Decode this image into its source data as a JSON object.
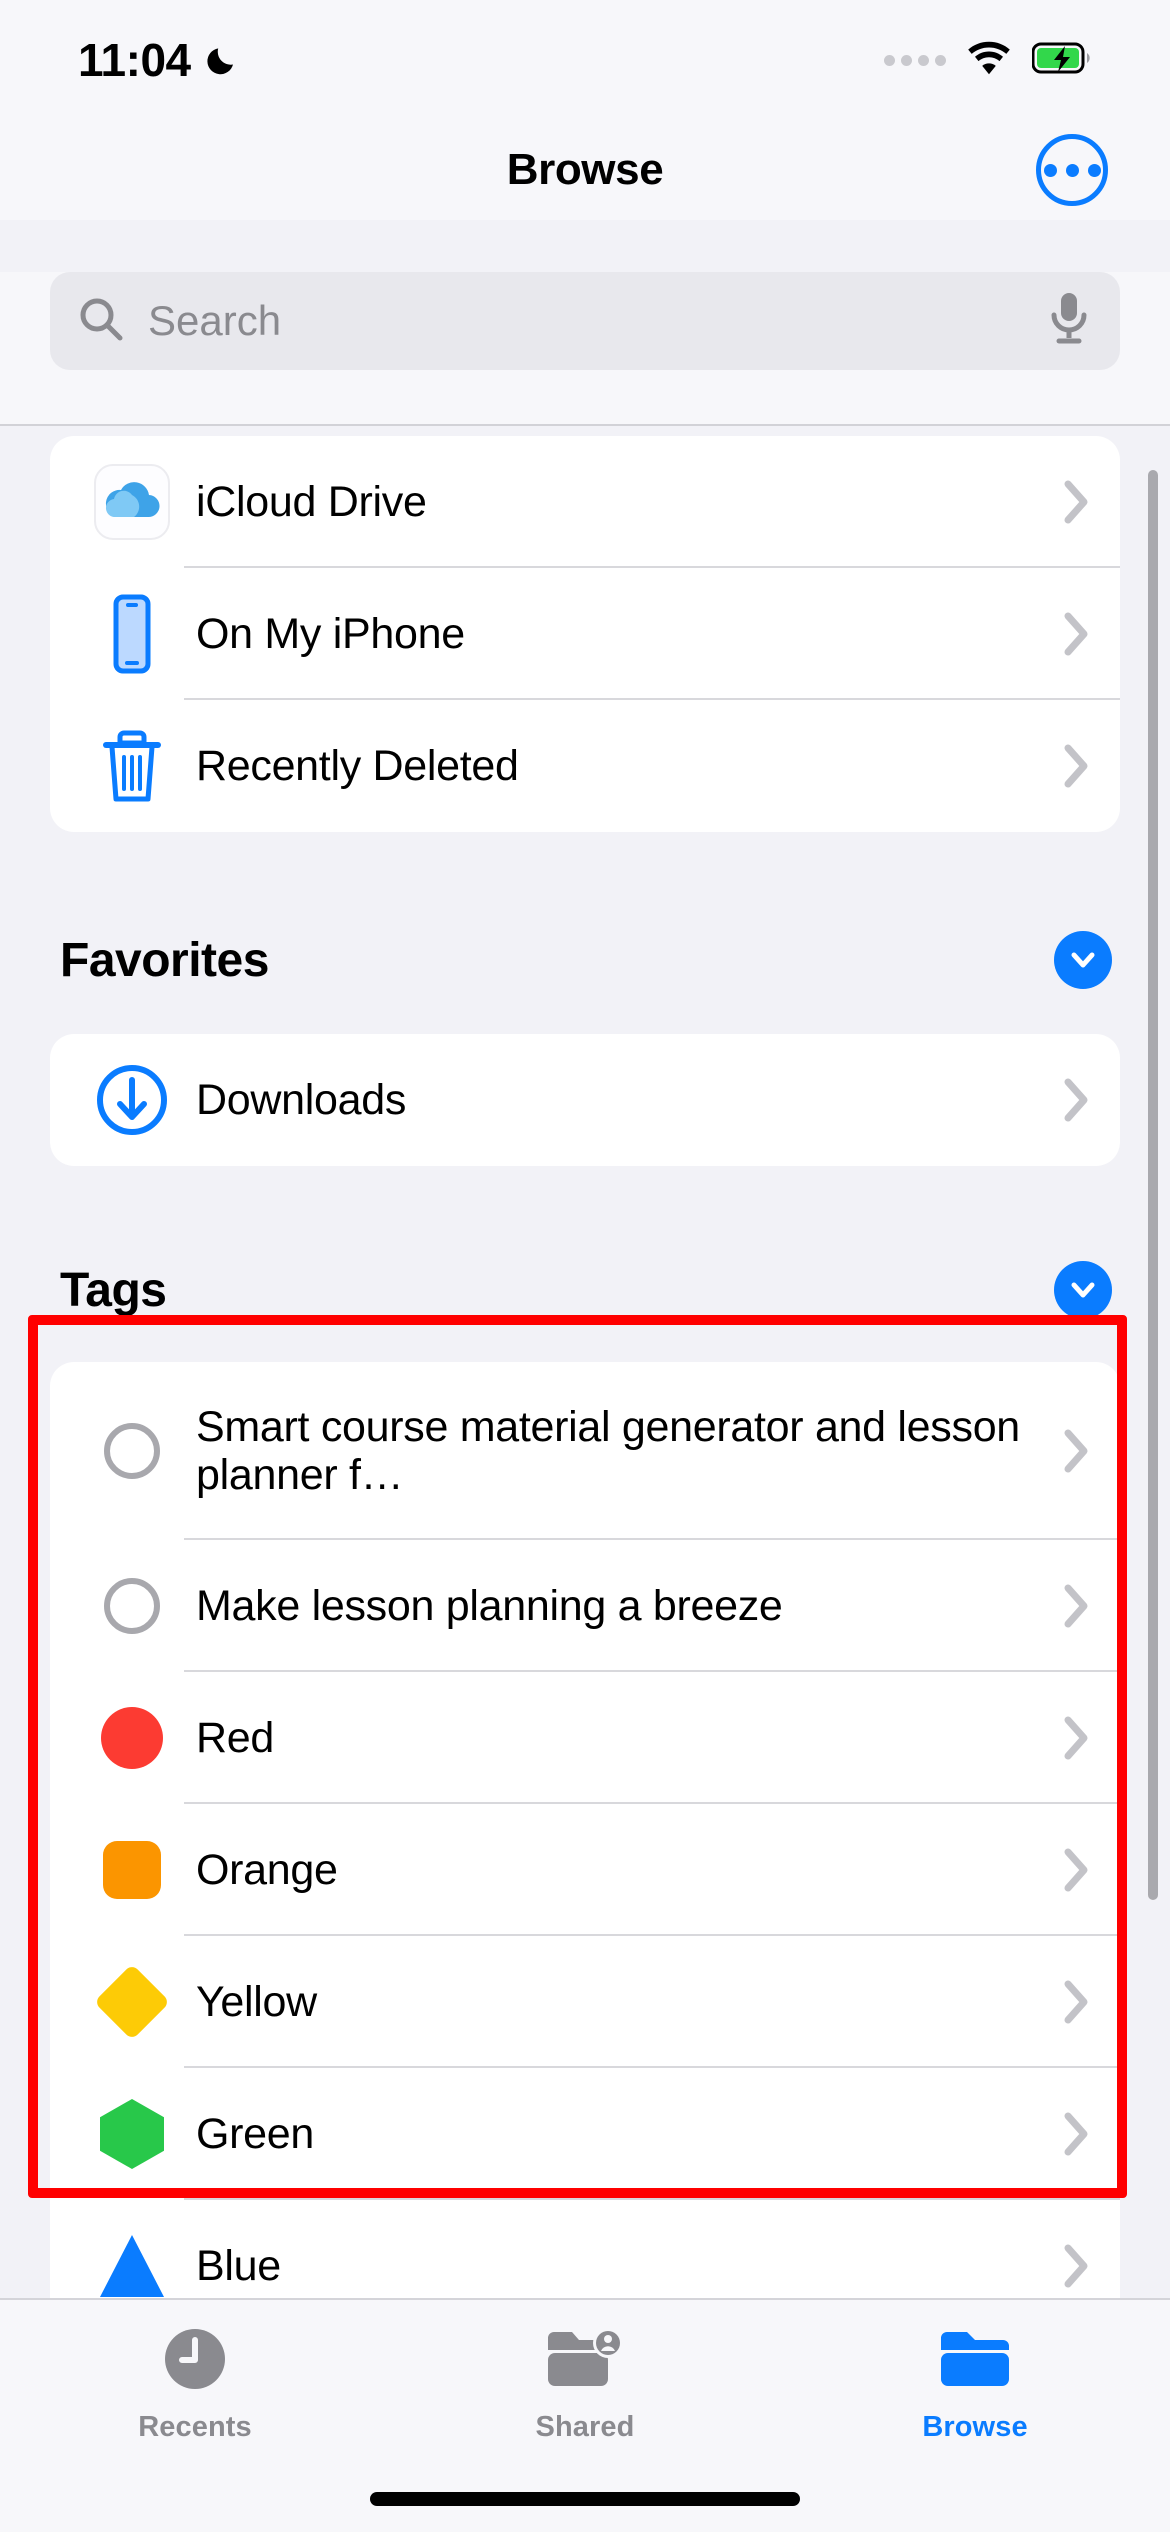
{
  "status_bar": {
    "time": "11:04",
    "dnd_icon": "crescent-moon-icon",
    "cellular_icon": "signal-dots-icon",
    "wifi_icon": "wifi-icon",
    "battery_icon": "battery-charging-icon",
    "battery_charging": true
  },
  "nav": {
    "title": "Browse",
    "more_button_icon": "ellipsis-circle-icon"
  },
  "search": {
    "placeholder": "Search",
    "value": "",
    "search_icon": "search-icon",
    "mic_icon": "microphone-icon"
  },
  "locations": {
    "items": [
      {
        "label": "iCloud Drive",
        "icon": "icloud-drive-icon",
        "chevron": "chevron-right-icon"
      },
      {
        "label": "On My iPhone",
        "icon": "iphone-icon",
        "chevron": "chevron-right-icon"
      },
      {
        "label": "Recently Deleted",
        "icon": "trash-icon",
        "chevron": "chevron-right-icon"
      }
    ]
  },
  "favorites": {
    "title": "Favorites",
    "collapse_icon": "chevron-down-circle-icon",
    "items": [
      {
        "label": "Downloads",
        "icon": "download-circle-icon",
        "chevron": "chevron-right-icon"
      }
    ]
  },
  "tags": {
    "title": "Tags",
    "collapse_icon": "chevron-down-circle-icon",
    "items": [
      {
        "label": "Smart course material generator and lesson planner f…",
        "shape": "ring",
        "color": "#a8a8ad",
        "chevron": "chevron-right-icon"
      },
      {
        "label": "Make lesson planning a breeze",
        "shape": "ring",
        "color": "#a8a8ad",
        "chevron": "chevron-right-icon"
      },
      {
        "label": "Red",
        "shape": "circle",
        "color": "#fc3b32",
        "chevron": "chevron-right-icon"
      },
      {
        "label": "Orange",
        "shape": "rounded-square",
        "color": "#fb9500",
        "chevron": "chevron-right-icon"
      },
      {
        "label": "Yellow",
        "shape": "diamond",
        "color": "#fdcb06",
        "chevron": "chevron-right-icon"
      },
      {
        "label": "Green",
        "shape": "hexagon",
        "color": "#28c council",
        "chevron": "chevron-right-icon"
      },
      {
        "label": "Blue",
        "shape": "triangle",
        "color": "#0a7cff",
        "chevron": "chevron-right-icon"
      }
    ]
  },
  "annotation": {
    "highlight_color": "#ff0000",
    "description": "red rectangle highlighting the Tags list rows"
  },
  "tabbar": {
    "tabs": [
      {
        "label": "Recents",
        "icon": "clock-icon",
        "active": false
      },
      {
        "label": "Shared",
        "icon": "shared-folder-person-icon",
        "active": false
      },
      {
        "label": "Browse",
        "icon": "folder-icon",
        "active": true
      }
    ]
  },
  "colors": {
    "accent": "#0a7cff",
    "background": "#f2f2f7",
    "card": "#ffffff",
    "inactive": "#8a8a8f"
  }
}
